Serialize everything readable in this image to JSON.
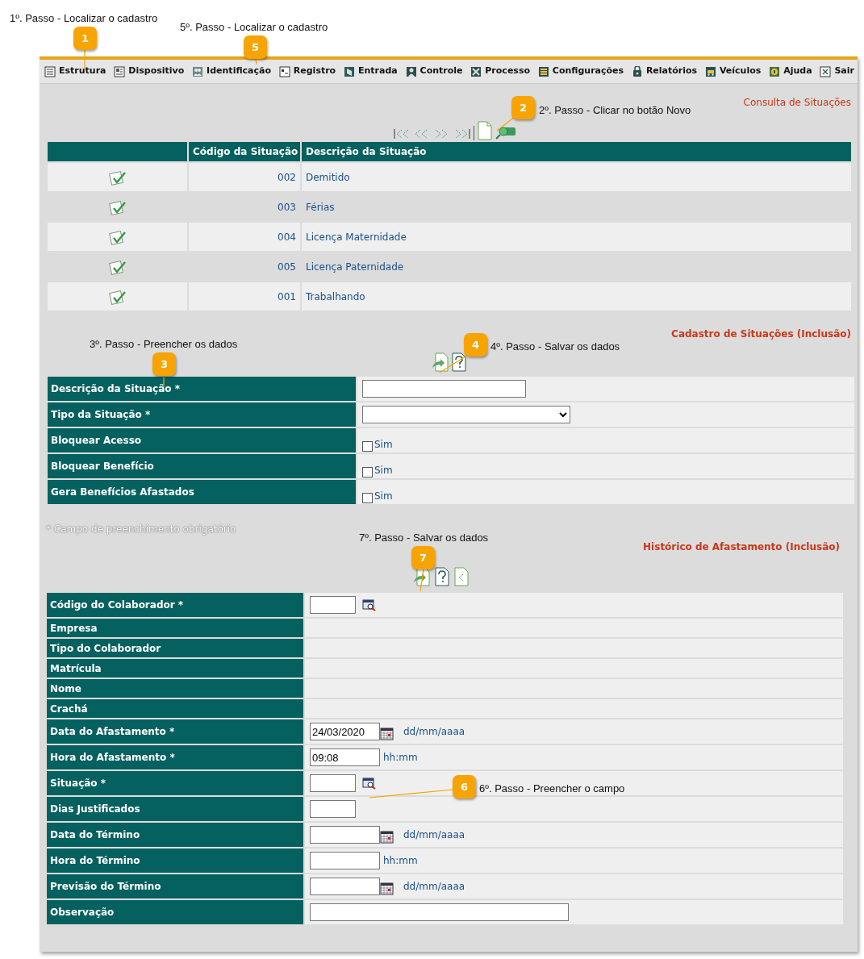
{
  "annotations": [
    {
      "number": "1",
      "text": "1º. Passo - Localizar o cadastro"
    },
    {
      "number": "5",
      "text": "5º. Passo - Localizar o cadastro"
    },
    {
      "number": "2",
      "text": "2º. Passo - Clicar no botão Novo"
    },
    {
      "number": "3",
      "text": "3º. Passo - Preencher os dados"
    },
    {
      "number": "4",
      "text": "4º. Passo - Salvar os dados"
    },
    {
      "number": "7",
      "text": "7º. Passo - Salvar os dados"
    },
    {
      "number": "6",
      "text": "6º. Passo - Preencher o campo"
    }
  ],
  "menu": [
    {
      "label": "Estrutura"
    },
    {
      "label": "Dispositivo"
    },
    {
      "label": "Identificação"
    },
    {
      "label": "Registro"
    },
    {
      "label": "Entrada"
    },
    {
      "label": "Controle"
    },
    {
      "label": "Processo"
    },
    {
      "label": "Configurações"
    },
    {
      "label": "Relatórios"
    },
    {
      "label": "Veículos"
    },
    {
      "label": "Ajuda"
    },
    {
      "label": "Sair"
    }
  ],
  "consulta": {
    "title": "Consulta de Situações",
    "columns": [
      "Código da Situação",
      "Descrição da Situação"
    ],
    "rows": [
      {
        "code": "002",
        "description": "Demitido"
      },
      {
        "code": "003",
        "description": "Férias"
      },
      {
        "code": "004",
        "description": "Licença Maternidade"
      },
      {
        "code": "005",
        "description": "Licença Paternidade"
      },
      {
        "code": "001",
        "description": "Trabalhando"
      }
    ]
  },
  "cadastro": {
    "title": "Cadastro de Situações (Inclusão)",
    "fields": [
      {
        "label": "Descrição da Situação *",
        "kind": "text"
      },
      {
        "label": "Tipo da Situação *",
        "kind": "select"
      },
      {
        "label": "Bloquear Acesso",
        "kind": "checkbox",
        "checked": false,
        "option": "Sim"
      },
      {
        "label": "Bloquear Benefício",
        "kind": "checkbox",
        "checked": false,
        "option": "Sim"
      },
      {
        "label": "Gera Benefícios Afastados",
        "kind": "checkbox",
        "checked": false,
        "option": "Sim"
      }
    ]
  },
  "required_note": "* Campo de preenchimento obrigatório",
  "historico": {
    "title": "Histórico de Afastamento (Inclusão)",
    "fields": [
      {
        "label": "Código do Colaborador *",
        "kind": "lookup"
      },
      {
        "label": "Empresa",
        "kind": "display"
      },
      {
        "label": "Tipo do Colaborador",
        "kind": "display"
      },
      {
        "label": "Matrícula",
        "kind": "display"
      },
      {
        "label": "Nome",
        "kind": "display"
      },
      {
        "label": "Crachá",
        "kind": "display"
      },
      {
        "label": "Data do Afastamento *",
        "kind": "date",
        "value": "24/03/2020",
        "hint": "dd/mm/aaaa"
      },
      {
        "label": "Hora do Afastamento *",
        "kind": "time",
        "value": "09:08",
        "hint": "hh:mm"
      },
      {
        "label": "Situação *",
        "kind": "lookup"
      },
      {
        "label": "Dias Justificados",
        "kind": "number"
      },
      {
        "label": "Data do Término",
        "kind": "date",
        "hint": "dd/mm/aaaa"
      },
      {
        "label": "Hora do Término",
        "kind": "time",
        "hint": "hh:mm"
      },
      {
        "label": "Previsão do Término",
        "kind": "date",
        "hint": "dd/mm/aaaa"
      },
      {
        "label": "Observação",
        "kind": "text"
      }
    ]
  }
}
